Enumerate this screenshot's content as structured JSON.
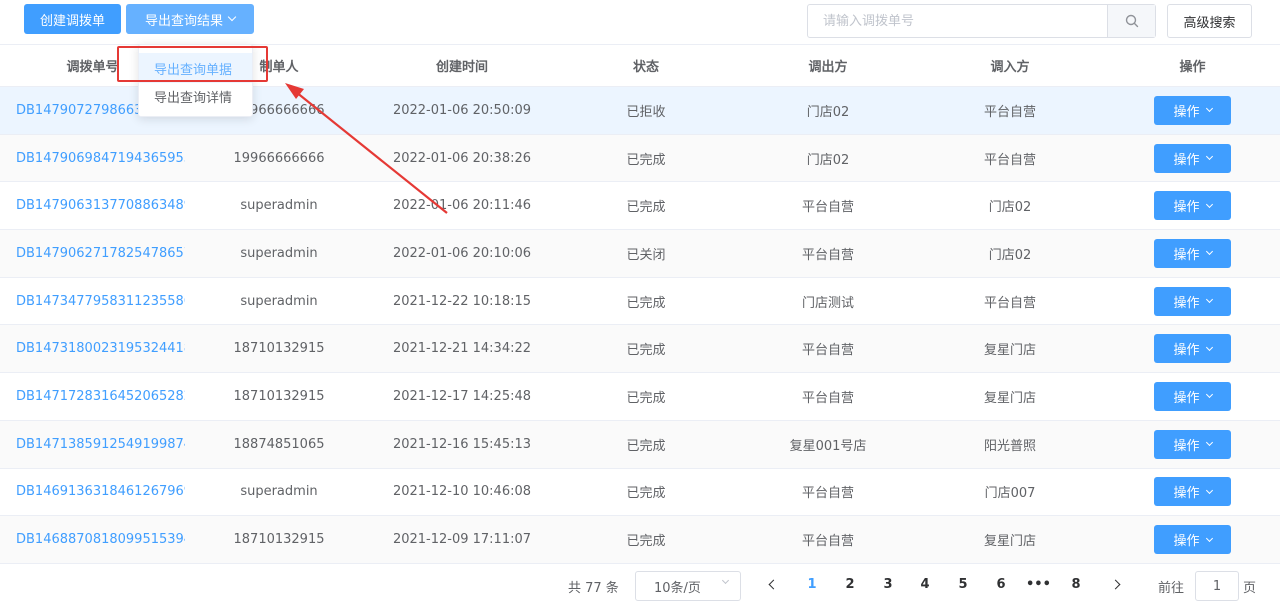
{
  "toolbar": {
    "create_label": "创建调拨单",
    "export_label": "导出查询结果",
    "search_placeholder": "请输入调拨单号",
    "advanced_label": "高级搜索"
  },
  "export_menu": {
    "items": [
      "导出查询单据",
      "导出查询详情"
    ]
  },
  "table": {
    "headers": [
      "调拨单号",
      "制单人",
      "创建时间",
      "状态",
      "调出方",
      "调入方",
      "操作"
    ],
    "rows": [
      {
        "no": "DB1479072798663168",
        "maker": "19966666666",
        "time": "2022-01-06 20:50:09",
        "status": "已拒收",
        "from": "门店02",
        "to": "平台自营",
        "op": "操作"
      },
      {
        "no": "DB1479069847194365953",
        "maker": "19966666666",
        "time": "2022-01-06 20:38:26",
        "status": "已完成",
        "from": "门店02",
        "to": "平台自营",
        "op": "操作"
      },
      {
        "no": "DB1479063137708863489",
        "maker": "superadmin",
        "time": "2022-01-06 20:11:46",
        "status": "已完成",
        "from": "平台自营",
        "to": "门店02",
        "op": "操作"
      },
      {
        "no": "DB1479062717825478657",
        "maker": "superadmin",
        "time": "2022-01-06 20:10:06",
        "status": "已关闭",
        "from": "平台自营",
        "to": "门店02",
        "op": "操作"
      },
      {
        "no": "DB1473477958311235586",
        "maker": "superadmin",
        "time": "2021-12-22 10:18:15",
        "status": "已完成",
        "from": "门店测试",
        "to": "平台自营",
        "op": "操作"
      },
      {
        "no": "DB1473180023195324418",
        "maker": "18710132915",
        "time": "2021-12-21 14:34:22",
        "status": "已完成",
        "from": "平台自营",
        "to": "复星门店",
        "op": "操作"
      },
      {
        "no": "DB1471728316452065282",
        "maker": "18710132915",
        "time": "2021-12-17 14:25:48",
        "status": "已完成",
        "from": "平台自营",
        "to": "复星门店",
        "op": "操作"
      },
      {
        "no": "DB1471385912549199874",
        "maker": "18874851065",
        "time": "2021-12-16 15:45:13",
        "status": "已完成",
        "from": "复星001号店",
        "to": "阳光普照",
        "op": "操作"
      },
      {
        "no": "DB1469136318461267969",
        "maker": "superadmin",
        "time": "2021-12-10 10:46:08",
        "status": "已完成",
        "from": "平台自营",
        "to": "门店007",
        "op": "操作"
      },
      {
        "no": "DB1468870818099515394",
        "maker": "18710132915",
        "time": "2021-12-09 17:11:07",
        "status": "已完成",
        "from": "平台自营",
        "to": "复星门店",
        "op": "操作"
      }
    ]
  },
  "pagination": {
    "total_text": "共 77 条",
    "page_size": "10条/页",
    "pages": [
      "1",
      "2",
      "3",
      "4",
      "5",
      "6",
      "•••",
      "8"
    ],
    "current_page": "1",
    "goto_label": "前往",
    "goto_value": "1",
    "page_unit": "页"
  },
  "colors": {
    "primary": "#409eff",
    "highlight_row": "#ecf5ff",
    "annotation": "#e53935"
  }
}
